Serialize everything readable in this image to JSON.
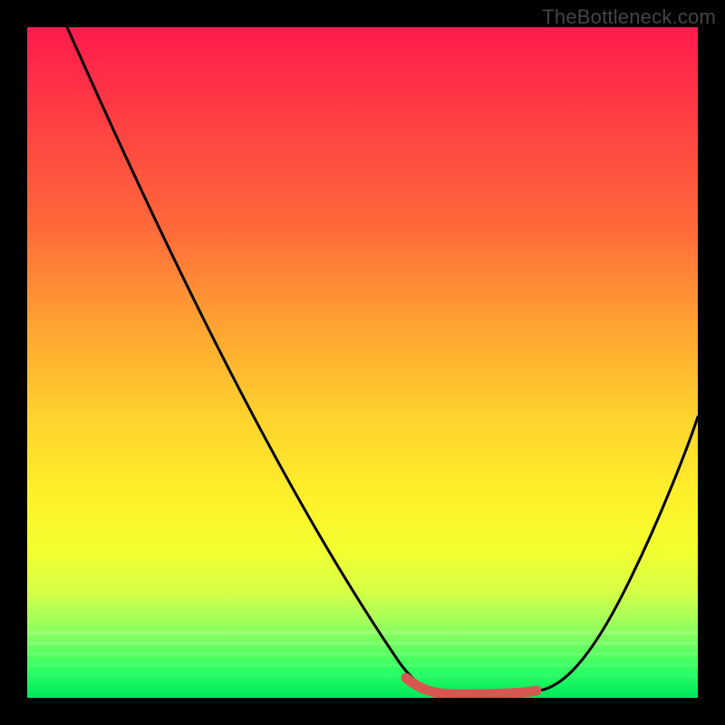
{
  "watermark": "TheBottleneck.com",
  "chart_data": {
    "type": "line",
    "title": "",
    "xlabel": "",
    "ylabel": "",
    "xlim": [
      0,
      100
    ],
    "ylim": [
      0,
      100
    ],
    "series": [
      {
        "name": "bottleneck-curve",
        "x": [
          6,
          10,
          15,
          20,
          25,
          30,
          35,
          40,
          45,
          50,
          55,
          58,
          60,
          63,
          66,
          70,
          74,
          78,
          82,
          86,
          90,
          94,
          98,
          100
        ],
        "values": [
          100,
          92,
          83,
          74,
          65,
          56,
          47,
          38,
          29,
          20,
          11,
          5,
          2,
          0,
          0,
          0,
          0,
          0,
          2,
          6,
          12,
          20,
          30,
          36
        ]
      },
      {
        "name": "highlight-segment",
        "x": [
          58,
          62,
          66,
          70,
          74,
          77
        ],
        "values": [
          1.5,
          0.8,
          0.8,
          0.8,
          1.0,
          1.5
        ]
      }
    ],
    "colors": {
      "curve": "#000000",
      "highlight": "#d4584f",
      "gradient_top": "#ff1a4d",
      "gradient_bottom": "#00e85c"
    }
  }
}
